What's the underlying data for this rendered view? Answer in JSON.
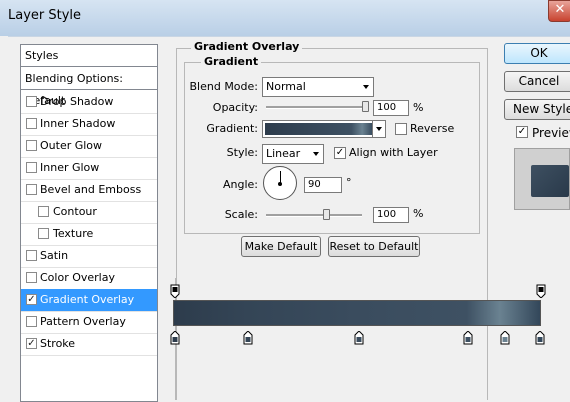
{
  "window": {
    "title": "Layer Style",
    "close_glyph": "✕"
  },
  "styles_panel": {
    "header": "Styles",
    "blending": "Blending Options: Default",
    "items": [
      {
        "label": "Drop Shadow",
        "checked": false
      },
      {
        "label": "Inner Shadow",
        "checked": false
      },
      {
        "label": "Outer Glow",
        "checked": false
      },
      {
        "label": "Inner Glow",
        "checked": false
      },
      {
        "label": "Bevel and Emboss",
        "checked": false
      },
      {
        "label": "Contour",
        "checked": false
      },
      {
        "label": "Texture",
        "checked": false
      },
      {
        "label": "Satin",
        "checked": false
      },
      {
        "label": "Color Overlay",
        "checked": false
      },
      {
        "label": "Gradient Overlay",
        "checked": true
      },
      {
        "label": "Pattern Overlay",
        "checked": false
      },
      {
        "label": "Stroke",
        "checked": true
      }
    ],
    "check_glyph": "✓"
  },
  "gradient_overlay": {
    "section_title": "Gradient Overlay",
    "group_title": "Gradient",
    "blend_mode_label": "Blend Mode:",
    "blend_mode_value": "Normal",
    "opacity_label": "Opacity:",
    "opacity_value": "100",
    "opacity_unit": "%",
    "opacity_level": 1.0,
    "gradient_label": "Gradient:",
    "reverse_label": "Reverse",
    "reverse_checked": false,
    "style_label": "Style:",
    "style_value": "Linear",
    "align_label": "Align with Layer",
    "align_checked": true,
    "angle_label": "Angle:",
    "angle_value": "90",
    "angle_unit": "°",
    "scale_label": "Scale:",
    "scale_value": "100",
    "scale_unit": "%",
    "make_default": "Make Default",
    "reset_default": "Reset to Default"
  },
  "actions": {
    "ok": "OK",
    "cancel": "Cancel",
    "new_style": "New Style...",
    "preview_label": "Preview",
    "preview_checked": true
  },
  "colors": {
    "selection": "#3399ff",
    "gradient_dark": "#2d3c4c",
    "gradient_light": "#6a8291"
  },
  "icons": {
    "dropdown": "chevron-down-icon",
    "angle": "angle-dial-icon",
    "stop": "gradient-stop-icon"
  }
}
